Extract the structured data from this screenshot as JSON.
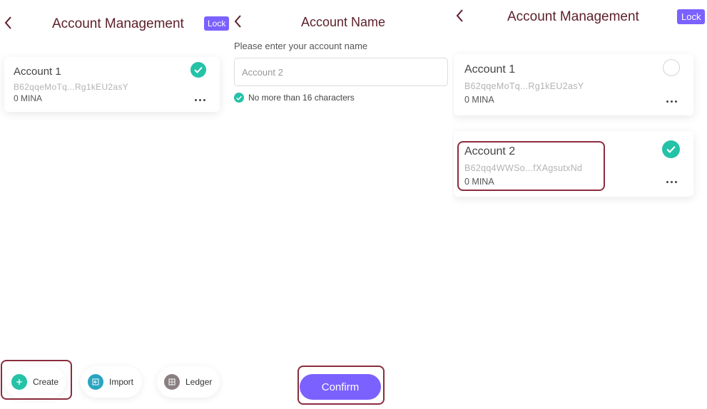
{
  "colors": {
    "accent": "#7b61ff",
    "title": "#5c1f2b",
    "check": "#24c2a7",
    "highlight": "#8b2c3e"
  },
  "panel_left": {
    "title": "Account Management",
    "lock_label": "Lock",
    "accounts": [
      {
        "name": "Account 1",
        "address": "B62qqeMoTq...Rg1kEU2asY",
        "balance": "0 MINA",
        "selected": true
      }
    ],
    "actions": [
      {
        "label": "Create",
        "icon": "plus-icon"
      },
      {
        "label": "Import",
        "icon": "import-icon"
      },
      {
        "label": "Ledger",
        "icon": "ledger-icon"
      }
    ]
  },
  "panel_middle": {
    "title": "Account Name",
    "input_label": "Please enter your account name",
    "input_placeholder": "Account 2",
    "hint": "No more than 16 characters",
    "confirm_label": "Confirm"
  },
  "panel_right": {
    "title": "Account Management",
    "lock_label": "Lock",
    "accounts": [
      {
        "name": "Account 1",
        "address": "B62qqeMoTq...Rg1kEU2asY",
        "balance": "0 MINA",
        "selected": false
      },
      {
        "name": "Account 2",
        "address": "B62qq4WWSo...fXAgsutxNd",
        "balance": "0 MINA",
        "selected": true
      }
    ]
  }
}
